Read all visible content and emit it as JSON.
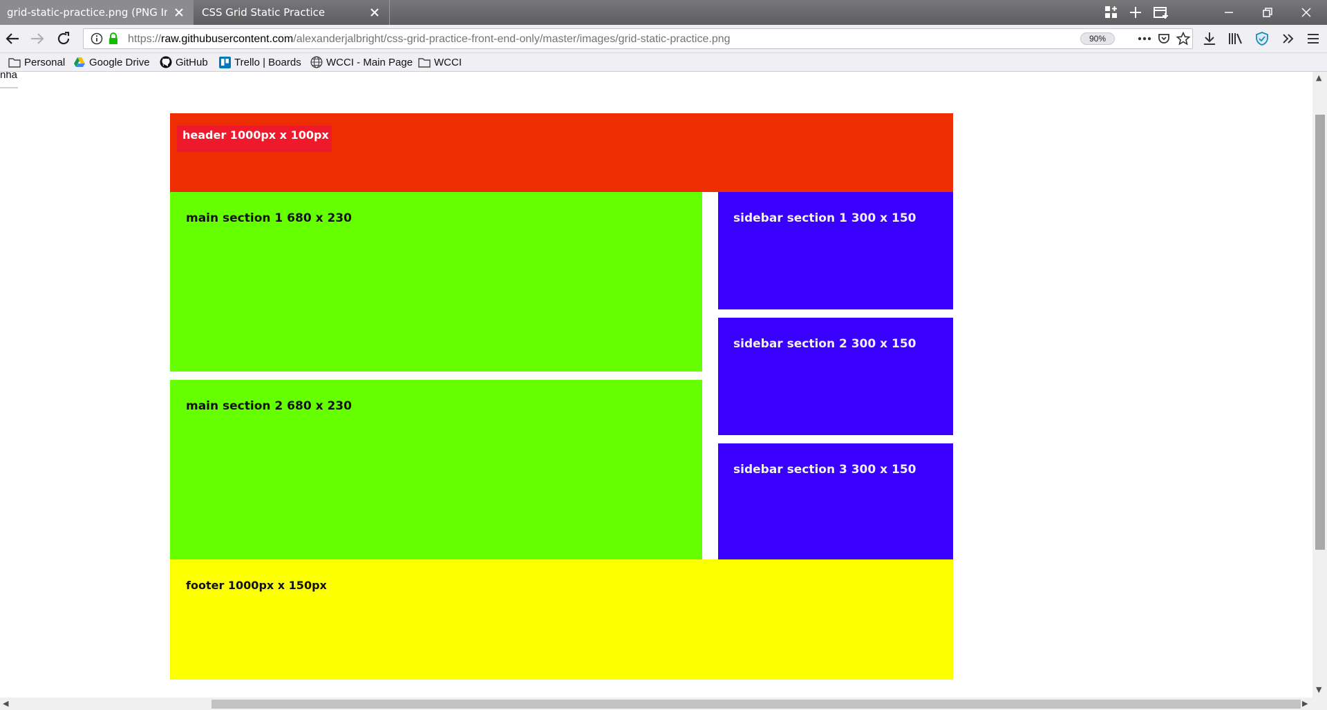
{
  "tabs": [
    {
      "title": "grid-static-practice.png (PNG Image",
      "active": true
    },
    {
      "title": "CSS Grid Static Practice",
      "active": false
    }
  ],
  "navbar": {
    "url_scheme": "https://",
    "url_host": "raw.githubusercontent.com",
    "url_path": "/alexanderjalbright/css-grid-practice-front-end-only/master/images/grid-static-practice.png",
    "zoom": "90%"
  },
  "bookmarks": [
    {
      "label": "Personal",
      "icon": "folder-icon"
    },
    {
      "label": "Google Drive",
      "icon": "google-drive-icon"
    },
    {
      "label": "GitHub",
      "icon": "github-icon"
    },
    {
      "label": "Trello | Boards",
      "icon": "trello-icon"
    },
    {
      "label": "WCCI - Main Page",
      "icon": "globe-icon"
    },
    {
      "label": "WCCI",
      "icon": "folder-icon"
    }
  ],
  "page": {
    "corner_text": "nha",
    "header": "header 1000px x 100px",
    "main_sections": [
      "main section 1 680 x 230",
      "main section 2 680 x 230"
    ],
    "sidebar_sections": [
      "sidebar section 1 300 x 150",
      "sidebar section 2 300 x 150",
      "sidebar section 3 300 x 150"
    ],
    "footer": "footer 1000px x 150px"
  },
  "colors": {
    "header": "#ee2e00",
    "header_label_bg": "#ee1a2c",
    "main": "#66ff00",
    "sidebar": "#3a00ff",
    "footer": "#fbff00"
  }
}
